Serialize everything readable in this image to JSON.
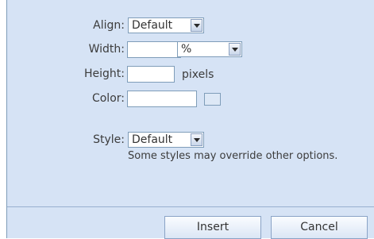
{
  "form": {
    "align": {
      "label": "Align:",
      "value": "Default"
    },
    "width": {
      "label": "Width:",
      "value": "",
      "unit": "%"
    },
    "height": {
      "label": "Height:",
      "value": "",
      "unit": "pixels"
    },
    "color": {
      "label": "Color:",
      "value": ""
    },
    "style": {
      "label": "Style:",
      "value": "Default",
      "note": "Some styles may override other options."
    }
  },
  "buttons": {
    "insert": "Insert",
    "cancel": "Cancel"
  },
  "icons": {
    "dropdown": "chevron-down-icon",
    "color_swatch": "color-swatch"
  }
}
